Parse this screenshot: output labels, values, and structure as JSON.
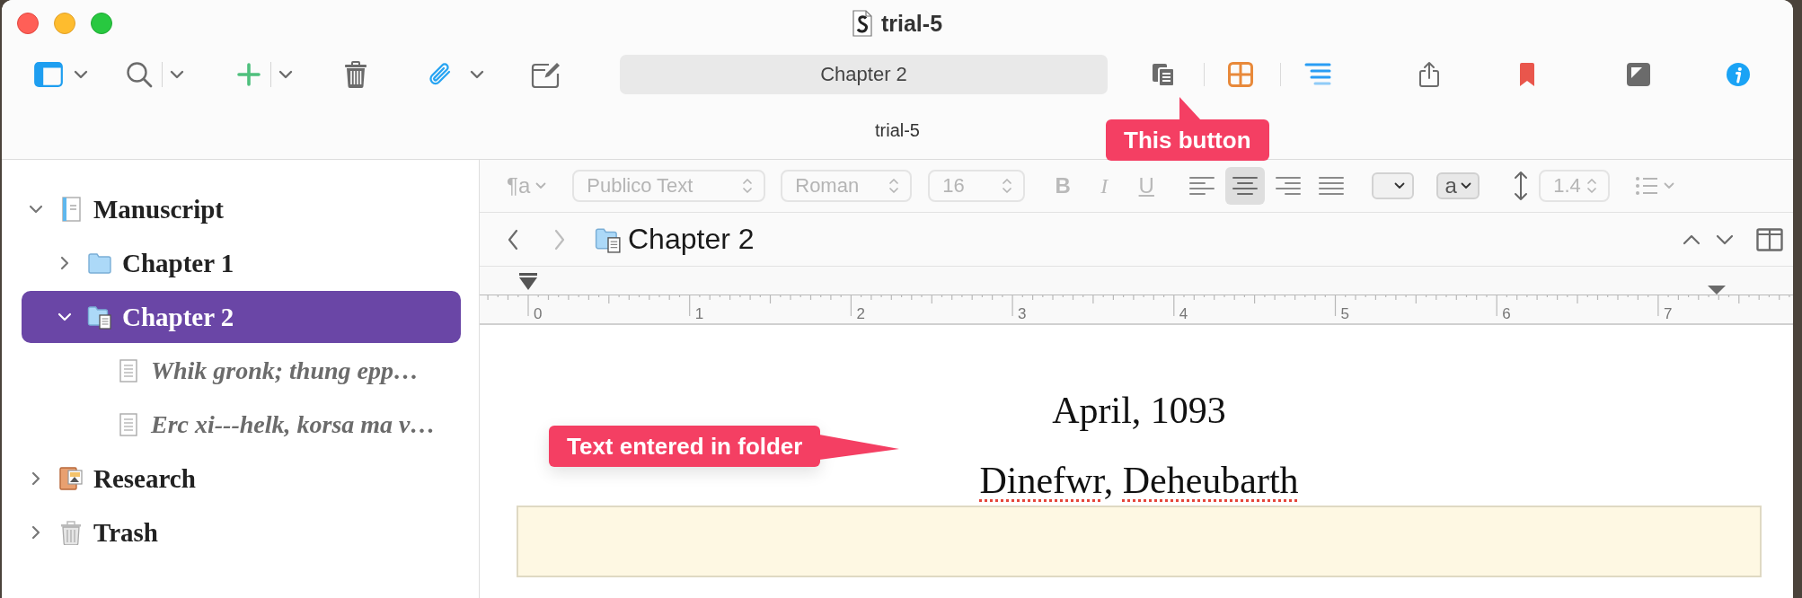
{
  "window": {
    "title": "trial-5"
  },
  "toolbar": {
    "document_title": "Chapter 2"
  },
  "tab_bar": {
    "label": "trial-5"
  },
  "binder": {
    "items": [
      {
        "label": "Manuscript",
        "kind": "draft",
        "expanded": true,
        "selected": false,
        "children": [
          {
            "label": "Chapter 1",
            "kind": "folder",
            "expanded": false,
            "selected": false
          },
          {
            "label": "Chapter 2",
            "kind": "textfolder",
            "expanded": true,
            "selected": true,
            "children": [
              {
                "label": "Whik gronk; thung epp…",
                "kind": "document",
                "selected": false
              },
              {
                "label": "Erc xi---helk, korsa ma v…",
                "kind": "document",
                "selected": false
              }
            ]
          }
        ]
      },
      {
        "label": "Research",
        "kind": "research",
        "expanded": false,
        "selected": false
      },
      {
        "label": "Trash",
        "kind": "trash",
        "expanded": false,
        "selected": false
      }
    ]
  },
  "format_bar": {
    "disabled": true,
    "paragraph_style": "¶a",
    "font_family": "Publico Text",
    "font_face": "Roman",
    "font_size": "16",
    "style_buttons": [
      {
        "kind": "bold",
        "label": "B"
      },
      {
        "kind": "italic",
        "label": "I"
      },
      {
        "kind": "underline",
        "label": "U"
      }
    ],
    "alignment": [
      {
        "kind": "left",
        "selected": false
      },
      {
        "kind": "center",
        "selected": true
      },
      {
        "kind": "right",
        "selected": false
      },
      {
        "kind": "justify",
        "selected": false
      }
    ],
    "text_color": "a",
    "line_spacing": "1.4"
  },
  "editor_header": {
    "title": "Chapter 2",
    "navigation": [
      {
        "kind": "back",
        "disabled": false
      },
      {
        "kind": "forward",
        "disabled": true
      }
    ]
  },
  "ruler": {
    "labels": [
      "0",
      "1",
      "2",
      "3",
      "4",
      "5",
      "6",
      "7"
    ]
  },
  "editor": {
    "paragraphs": [
      {
        "runs": [
          {
            "text": "April, 1093",
            "misspelled": false
          }
        ]
      },
      {
        "runs": [
          {
            "text": "Dinefwr",
            "misspelled": true
          },
          {
            "text": ", ",
            "misspelled": false
          },
          {
            "text": "Deheubarth",
            "misspelled": true
          }
        ]
      }
    ]
  },
  "callouts": [
    {
      "text": "This button",
      "kind": "up"
    },
    {
      "text": "Text entered in folder",
      "kind": "right"
    }
  ]
}
